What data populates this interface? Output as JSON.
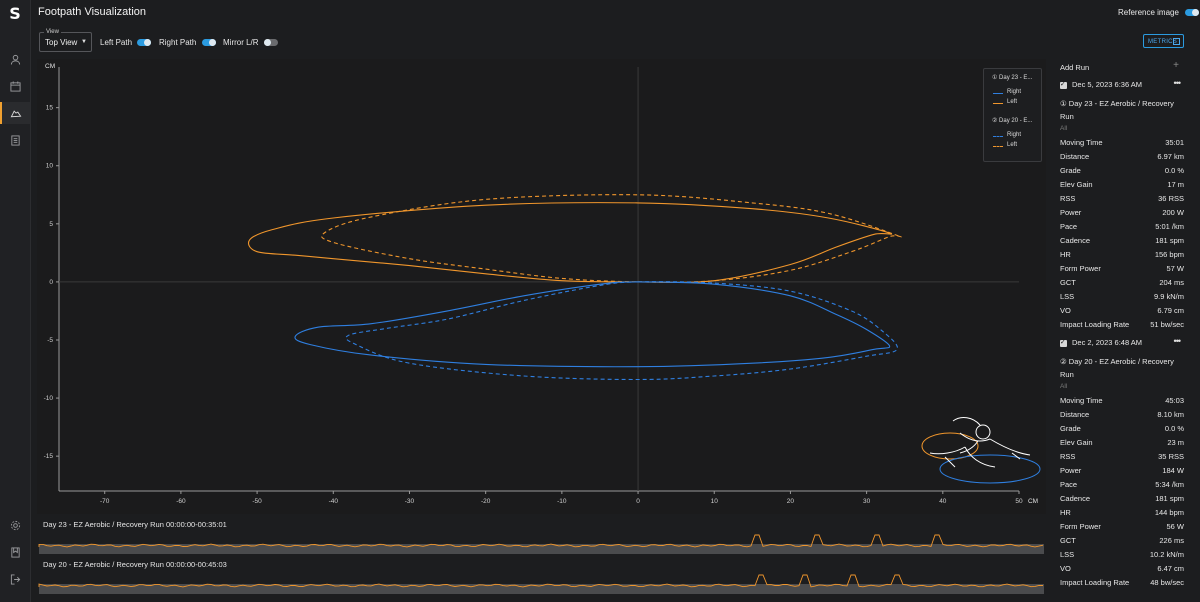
{
  "app": {
    "title": "Footpath Visualization",
    "logo": "S"
  },
  "header": {
    "reference_image_label": "Reference image",
    "reference_image_on": true
  },
  "toolbar": {
    "view_label": "View",
    "view_value": "Top View",
    "left_path_label": "Left Path",
    "right_path_label": "Right Path",
    "mirror_label": "Mirror L/R",
    "metrics_label": "METRICS"
  },
  "sidebar": {
    "icons": [
      "user-icon",
      "calendar-icon",
      "shoe-icon",
      "report-icon",
      "settings-icon",
      "bookmark-icon",
      "logout-icon"
    ]
  },
  "chart_data": {
    "type": "line",
    "xlabel": "CM",
    "ylabel": "CM",
    "xlim": [
      -76,
      50
    ],
    "ylim": [
      -18,
      18.5
    ],
    "x_ticks": [
      -70,
      -60,
      -50,
      -40,
      -30,
      -20,
      -10,
      0,
      10,
      20,
      30,
      40,
      50
    ],
    "y_ticks": [
      15,
      10,
      5,
      0,
      -5,
      -10,
      -15
    ],
    "colors": {
      "right": "#2f7fe0",
      "left": "#f0962c"
    },
    "legend": [
      {
        "title": "① Day 23 - E...",
        "entries": [
          {
            "name": "Right",
            "style": "solid",
            "color": "#2f7fe0"
          },
          {
            "name": "Left",
            "style": "solid",
            "color": "#f0962c"
          }
        ]
      },
      {
        "title": "② Day 20 - E...",
        "entries": [
          {
            "name": "Right",
            "style": "dashed",
            "color": "#2f7fe0"
          },
          {
            "name": "Left",
            "style": "dashed",
            "color": "#f0962c"
          }
        ]
      }
    ],
    "series": [
      {
        "run": 1,
        "side": "Left",
        "style": "solid",
        "color": "#f0962c",
        "points": [
          [
            0,
            0
          ],
          [
            10,
            0.1
          ],
          [
            20,
            1.5
          ],
          [
            26,
            3
          ],
          [
            31,
            4.1
          ],
          [
            33,
            4.2
          ],
          [
            25,
            5.5
          ],
          [
            15,
            6.3
          ],
          [
            0,
            6.8
          ],
          [
            -20,
            6.6
          ],
          [
            -40,
            5.5
          ],
          [
            -48,
            4.5
          ],
          [
            -51,
            3.6
          ],
          [
            -50,
            2.6
          ],
          [
            -45,
            2.3
          ],
          [
            -40,
            2
          ],
          [
            -30,
            1.4
          ],
          [
            -20,
            0.7
          ],
          [
            -10,
            0.1
          ],
          [
            0,
            0
          ]
        ]
      },
      {
        "run": 2,
        "side": "Left",
        "style": "dashed",
        "color": "#f0962c",
        "points": [
          [
            0,
            0
          ],
          [
            10,
            0.1
          ],
          [
            20,
            1
          ],
          [
            28,
            2.6
          ],
          [
            33,
            3.9
          ],
          [
            34,
            4
          ],
          [
            25,
            5.9
          ],
          [
            15,
            6.8
          ],
          [
            0,
            7.5
          ],
          [
            -20,
            7.1
          ],
          [
            -35,
            5.6
          ],
          [
            -41,
            4.3
          ],
          [
            -40,
            3.4
          ],
          [
            -30,
            2
          ],
          [
            -20,
            1.1
          ],
          [
            -10,
            0.3
          ],
          [
            0,
            0
          ]
        ]
      },
      {
        "run": 1,
        "side": "Right",
        "style": "solid",
        "color": "#2f7fe0",
        "points": [
          [
            0,
            0
          ],
          [
            10,
            -0.2
          ],
          [
            20,
            -1.2
          ],
          [
            26,
            -2.8
          ],
          [
            30,
            -4.1
          ],
          [
            33,
            -5.5
          ],
          [
            31,
            -5.8
          ],
          [
            25,
            -6.5
          ],
          [
            15,
            -7
          ],
          [
            0,
            -7.3
          ],
          [
            -20,
            -7.1
          ],
          [
            -35,
            -6.3
          ],
          [
            -43,
            -5.4
          ],
          [
            -45,
            -4.7
          ],
          [
            -42,
            -3.9
          ],
          [
            -35,
            -3.6
          ],
          [
            -25,
            -2.5
          ],
          [
            -15,
            -1.2
          ],
          [
            -5,
            -0.2
          ],
          [
            0,
            0
          ]
        ]
      },
      {
        "run": 2,
        "side": "Right",
        "style": "dashed",
        "color": "#2f7fe0",
        "points": [
          [
            0,
            0
          ],
          [
            10,
            -0.1
          ],
          [
            20,
            -0.8
          ],
          [
            28,
            -2.5
          ],
          [
            32,
            -4.2
          ],
          [
            34,
            -5.8
          ],
          [
            30,
            -6.4
          ],
          [
            20,
            -7.5
          ],
          [
            10,
            -8.1
          ],
          [
            0,
            -8.4
          ],
          [
            -15,
            -8.1
          ],
          [
            -30,
            -7
          ],
          [
            -37,
            -5.4
          ],
          [
            -38,
            -4.6
          ],
          [
            -33,
            -4
          ],
          [
            -25,
            -3.2
          ],
          [
            -15,
            -1.6
          ],
          [
            -5,
            -0.3
          ],
          [
            0,
            0
          ]
        ]
      }
    ]
  },
  "runs_timeline": [
    {
      "label": "Day 23 - EZ Aerobic / Recovery Run  00:00:00-00:35:01",
      "color": "#f0962c",
      "peaks": [
        0.713,
        0.773,
        0.833,
        0.893
      ]
    },
    {
      "label": "Day 20 - EZ Aerobic / Recovery Run  00:00:00-00:45:03",
      "color": "#f0962c",
      "peaks": [
        0.718,
        0.763,
        0.808,
        0.853
      ]
    }
  ],
  "panel": {
    "add_run_label": "Add Run",
    "runs": [
      {
        "date": "Dec 5, 2023 6:36 AM",
        "name": "① Day 23 - EZ Aerobic / Recovery Run",
        "filter": "All",
        "metrics": [
          [
            "Moving Time",
            "35:01"
          ],
          [
            "Distance",
            "6.97 km"
          ],
          [
            "Grade",
            "0.0 %"
          ],
          [
            "Elev Gain",
            "17 m"
          ],
          [
            "RSS",
            "36 RSS"
          ],
          [
            "Power",
            "200 W"
          ],
          [
            "Pace",
            "5:01 /km"
          ],
          [
            "Cadence",
            "181 spm"
          ],
          [
            "HR",
            "156 bpm"
          ],
          [
            "Form Power",
            "57 W"
          ],
          [
            "GCT",
            "204 ms"
          ],
          [
            "LSS",
            "9.9 kN/m"
          ],
          [
            "VO",
            "6.79 cm"
          ],
          [
            "Impact Loading Rate",
            "51 bw/sec"
          ]
        ]
      },
      {
        "date": "Dec 2, 2023 6:48 AM",
        "name": "② Day 20 - EZ Aerobic / Recovery Run",
        "filter": "All",
        "metrics": [
          [
            "Moving Time",
            "45:03"
          ],
          [
            "Distance",
            "8.10 km"
          ],
          [
            "Grade",
            "0.0 %"
          ],
          [
            "Elev Gain",
            "23 m"
          ],
          [
            "RSS",
            "35 RSS"
          ],
          [
            "Power",
            "184 W"
          ],
          [
            "Pace",
            "5:34 /km"
          ],
          [
            "Cadence",
            "181 spm"
          ],
          [
            "HR",
            "144 bpm"
          ],
          [
            "Form Power",
            "56 W"
          ],
          [
            "GCT",
            "226 ms"
          ],
          [
            "LSS",
            "10.2 kN/m"
          ],
          [
            "VO",
            "6.47 cm"
          ],
          [
            "Impact Loading Rate",
            "48 bw/sec"
          ]
        ]
      }
    ]
  }
}
